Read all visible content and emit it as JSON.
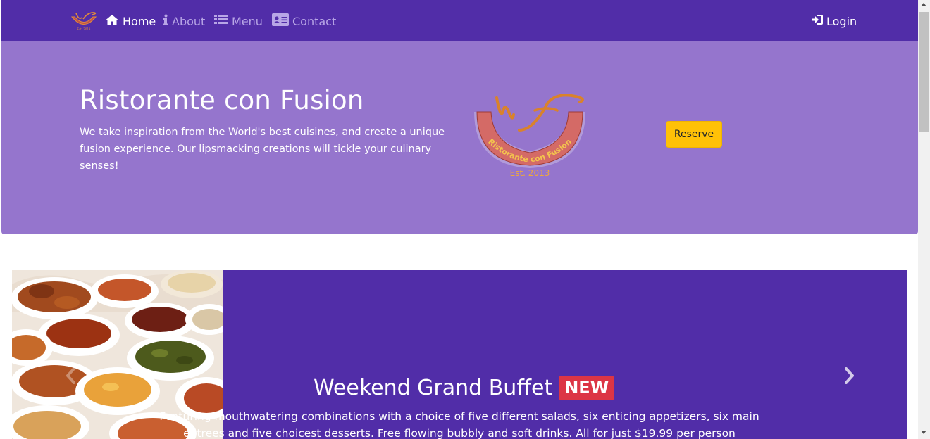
{
  "navbar": {
    "brand_logo": "ristorante-con-fusion-logo",
    "items": [
      {
        "label": "Home",
        "icon": "home-icon",
        "active": true
      },
      {
        "label": "About",
        "icon": "info-icon",
        "active": false
      },
      {
        "label": "Menu",
        "icon": "list-icon",
        "active": false
      },
      {
        "label": "Contact",
        "icon": "address-card-icon",
        "active": false
      }
    ],
    "login": {
      "label": "Login",
      "icon": "sign-in-icon"
    }
  },
  "jumbotron": {
    "title": "Ristorante con Fusion",
    "text": "We take inspiration from the World's best cuisines, and create a unique fusion experience. Our lipsmacking creations will tickle your culinary senses!",
    "logo": {
      "arc_text": "Ristorante con Fusion",
      "est_text": "Est. 2013"
    },
    "reserve_label": "Reserve"
  },
  "carousel": {
    "image": "buffet-dishes-image",
    "title": "Weekend Grand Buffet",
    "badge": "NEW",
    "text": "Featuring mouthwatering combinations with a choice of five different salads, six enticing appetizers, six main entrees and five choicest desserts. Free flowing bubbly and soft drinks. All for just $19.99 per person",
    "prev_icon": "chevron-left-icon",
    "next_icon": "chevron-right-icon"
  },
  "colors": {
    "primary": "#512da8",
    "jumbotron": "#9575cd",
    "reserve": "#ffc107",
    "badge": "#dc3545",
    "nav_inactive": "#b8a6e6"
  }
}
